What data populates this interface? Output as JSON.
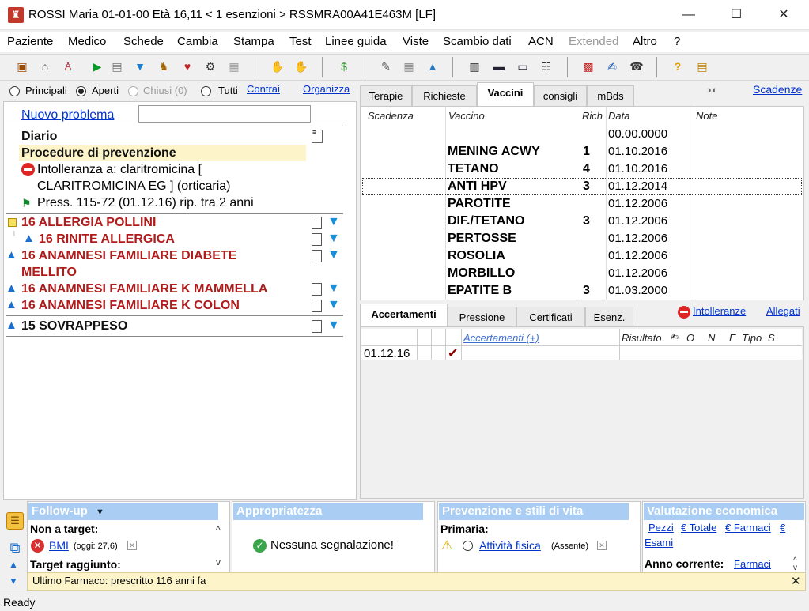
{
  "window": {
    "title": "ROSSI Maria  01-01-00  Età 16,11  < 1 esenzioni >  RSSMRA00A41E463M  [LF]",
    "icon": "castle-icon",
    "minimize": "—",
    "maximize": "☐",
    "close": "✕"
  },
  "menu": [
    "Paziente",
    "Medico",
    "Schede",
    "Cambia",
    "Stampa",
    "Test",
    "Linee guida",
    "Viste",
    "Scambio dati",
    "ACN",
    "Extended",
    "Altro",
    "?"
  ],
  "filters": {
    "principali": "Principali",
    "aperti": "Aperti",
    "chiusi": "Chiusi (0)",
    "tutti": "Tutti",
    "contrai": "Contrai",
    "organizza": "Organizza"
  },
  "left": {
    "nuovo_problema": "Nuovo problema",
    "nuovo_problema_value": "",
    "diario": "Diario",
    "procedure": "Procedure di prevenzione",
    "intolleranza_line1": "Intolleranza a: claritromicina [",
    "intolleranza_line2": "CLARITROMICINA EG ] (orticaria)",
    "press": "Press. 115-72 (01.12.16) rip. tra 2 anni",
    "problems": [
      "16 ALLERGIA POLLINI",
      "16 RINITE ALLERGICA",
      "16 ANAMNESI FAMILIARE DIABETE",
      "MELLITO",
      "16 ANAMNESI FAMILIARE K MAMMELLA",
      "16 ANAMNESI FAMILIARE K COLON",
      "15 SOVRAPPESO"
    ]
  },
  "tabs_top": [
    "Terapie",
    "Richieste",
    "Vaccini",
    "consigli",
    "mBds"
  ],
  "scadenze": "Scadenze",
  "vaccini": {
    "headers": [
      "Scadenza",
      "Vaccino",
      "Rich",
      "Data",
      "Note"
    ],
    "rows": [
      {
        "vaccino": "",
        "rich": "",
        "data": "00.00.0000"
      },
      {
        "vaccino": "MENING ACWY",
        "rich": "1",
        "data": "01.10.2016"
      },
      {
        "vaccino": "TETANO",
        "rich": "4",
        "data": "01.10.2016"
      },
      {
        "vaccino": "ANTI HPV",
        "rich": "3",
        "data": "01.12.2014"
      },
      {
        "vaccino": "PAROTITE",
        "rich": "",
        "data": "01.12.2006"
      },
      {
        "vaccino": "DIF./TETANO",
        "rich": "3",
        "data": "01.12.2006"
      },
      {
        "vaccino": "PERTOSSE",
        "rich": "",
        "data": "01.12.2006"
      },
      {
        "vaccino": "ROSOLIA",
        "rich": "",
        "data": "01.12.2006"
      },
      {
        "vaccino": "MORBILLO",
        "rich": "",
        "data": "01.12.2006"
      },
      {
        "vaccino": "EPATITE B",
        "rich": "3",
        "data": "01.03.2000"
      }
    ]
  },
  "tabs_mid": [
    "Accertamenti",
    "Pressione",
    "Certificati",
    "Esenz."
  ],
  "intolleranze": "Intolleranze",
  "allegati": "Allegati",
  "accertamenti": {
    "headers": [
      "Accertamenti (+)",
      "Risultato",
      "O",
      "N",
      "E",
      "Tipo",
      "S"
    ],
    "rows": [
      {
        "date": "01.12.16",
        "check": "✔"
      }
    ]
  },
  "followup": {
    "title": "Follow-up",
    "non_target": "Non a target:",
    "bmi": "BMI",
    "bmi_detail": "(oggi: 27,6)",
    "target": "Target raggiunto:"
  },
  "appropriatezza": {
    "title": "Appropriatezza",
    "message": "Nessuna segnalazione!"
  },
  "prevenzione": {
    "title": "Prevenzione e stili di vita",
    "primaria": "Primaria:",
    "attivita": "Attività fisica",
    "assente": "(Assente)"
  },
  "valutazione": {
    "title": "Valutazione economica",
    "links": [
      "Pezzi",
      "€ Totale",
      "€ Farmaci",
      "€"
    ],
    "esami": "Esami",
    "anno": "Anno corrente:",
    "farmaci": "Farmaci"
  },
  "ultimo_farmaco": "Ultimo Farmaco:  prescritto 116 anni fa",
  "status": "Ready",
  "colors": {
    "accent_blue": "#a9cdf3",
    "problem_red": "#b01c1c",
    "link_blue": "#0033cc",
    "highlight_yellow": "#fdf5c9"
  }
}
